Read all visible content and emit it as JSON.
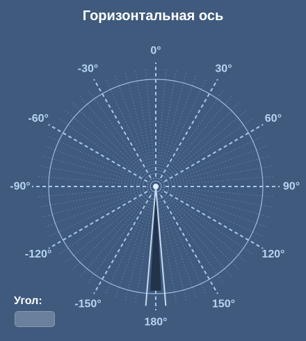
{
  "title": "Горизонтальная ось",
  "dial": {
    "tick_labels": [
      {
        "angle": 0,
        "text": "0°"
      },
      {
        "angle": 30,
        "text": "30°"
      },
      {
        "angle": 60,
        "text": "60°"
      },
      {
        "angle": 90,
        "text": "90°"
      },
      {
        "angle": 120,
        "text": "120°"
      },
      {
        "angle": 150,
        "text": "150°"
      },
      {
        "angle": 180,
        "text": "180°"
      },
      {
        "angle": -150,
        "text": "-150°"
      },
      {
        "angle": -120,
        "text": "-120°"
      },
      {
        "angle": -90,
        "text": "-90°"
      },
      {
        "angle": -60,
        "text": "-60°"
      },
      {
        "angle": -30,
        "text": "-30°"
      }
    ],
    "pointer_angle": 180,
    "colors": {
      "background": "#3f5a7d",
      "lines": "#a8c8ec",
      "circle": "#9fbadb",
      "pointer_fill": "#23334a",
      "pointer_stroke": "#c4daf3"
    }
  },
  "angle_input": {
    "label": "Угол:",
    "value": ""
  }
}
